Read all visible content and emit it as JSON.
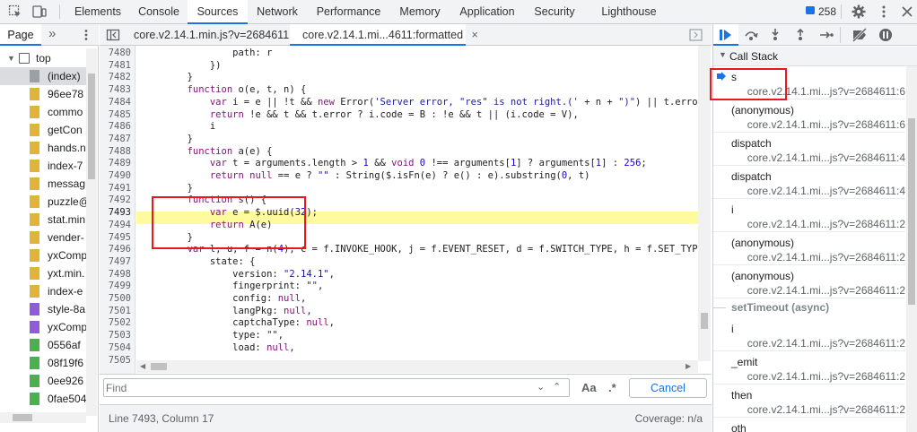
{
  "toolbar": {
    "tabs": [
      "Elements",
      "Console",
      "Sources",
      "Network",
      "Performance",
      "Memory",
      "Application",
      "Security",
      "Lighthouse"
    ],
    "active_tab": "Sources",
    "issues_count": "258"
  },
  "navigator": {
    "tab_label": "Page",
    "more_label": "»",
    "tree_root": "top",
    "files": [
      "(index)",
      "96ee78",
      "commo",
      "getCon",
      "hands.n",
      "index-7",
      "messag",
      "puzzle@",
      "stat.min",
      "vender-",
      "yxComp",
      "yxt.min.",
      "index-e",
      "style-8a",
      "yxComp",
      "0556af",
      "08f19f6",
      "0ee926",
      "0fae504"
    ],
    "file_colors": [
      "#9aa0a6",
      "#e0b33a",
      "#e0b33a",
      "#e0b33a",
      "#e0b33a",
      "#e0b33a",
      "#e0b33a",
      "#e0b33a",
      "#e0b33a",
      "#e0b33a",
      "#e0b33a",
      "#e0b33a",
      "#e0b33a",
      "#8e5cd9",
      "#8e5cd9",
      "#4caf50",
      "#4caf50",
      "#4caf50",
      "#4caf50"
    ]
  },
  "editor": {
    "tabs": [
      {
        "label": "core.v2.14.1.min.js?v=2684611",
        "active": false
      },
      {
        "label": "core.v2.14.1.mi...4611:formatted",
        "active": true
      }
    ],
    "close_label": "×",
    "line_numbers": [
      "7480",
      "7481",
      "7482",
      "7483",
      "7484",
      "7485",
      "7486",
      "7487",
      "7488",
      "7489",
      "7490",
      "7491",
      "7492",
      "7493",
      "7494",
      "7495",
      "7496",
      "7497",
      "7498",
      "7499",
      "7500",
      "7501",
      "7502",
      "7503",
      "7504",
      "7505"
    ],
    "highlighted_line": "7493",
    "search_placeholder": "Find",
    "match_case_label": "Aa",
    "regex_label": ".*",
    "cancel_label": "Cancel",
    "status_position": "Line 7493, Column 17",
    "status_coverage": "Coverage: n/a"
  },
  "debugger": {
    "section_title": "Call Stack",
    "frames": [
      {
        "name": "s",
        "location": "core.v2.14.1.mi...js?v=2684611:6",
        "current": true
      },
      {
        "name": "(anonymous)",
        "location": "core.v2.14.1.mi...js?v=2684611:6"
      },
      {
        "name": "dispatch",
        "location": "core.v2.14.1.mi...js?v=2684611:4"
      },
      {
        "name": "dispatch",
        "location": "core.v2.14.1.mi...js?v=2684611:4"
      },
      {
        "name": "i",
        "location": "core.v2.14.1.mi...js?v=2684611:2"
      },
      {
        "name": "(anonymous)",
        "location": "core.v2.14.1.mi...js?v=2684611:2"
      },
      {
        "name": "(anonymous)",
        "location": "core.v2.14.1.mi...js?v=2684611:2"
      }
    ],
    "async_label": "setTimeout (async)",
    "async_frames": [
      {
        "name": "i",
        "location": "core.v2.14.1.mi...js?v=2684611:2"
      },
      {
        "name": "_emit",
        "location": "core.v2.14.1.mi...js?v=2684611:2"
      },
      {
        "name": "then",
        "location": "core.v2.14.1.mi...js?v=2684611:2"
      }
    ],
    "partial_frame_name": "oth"
  },
  "colors": {
    "accent": "#1a73e8",
    "highlight": "#fffa9e",
    "annotation_red": "#e8191b"
  }
}
